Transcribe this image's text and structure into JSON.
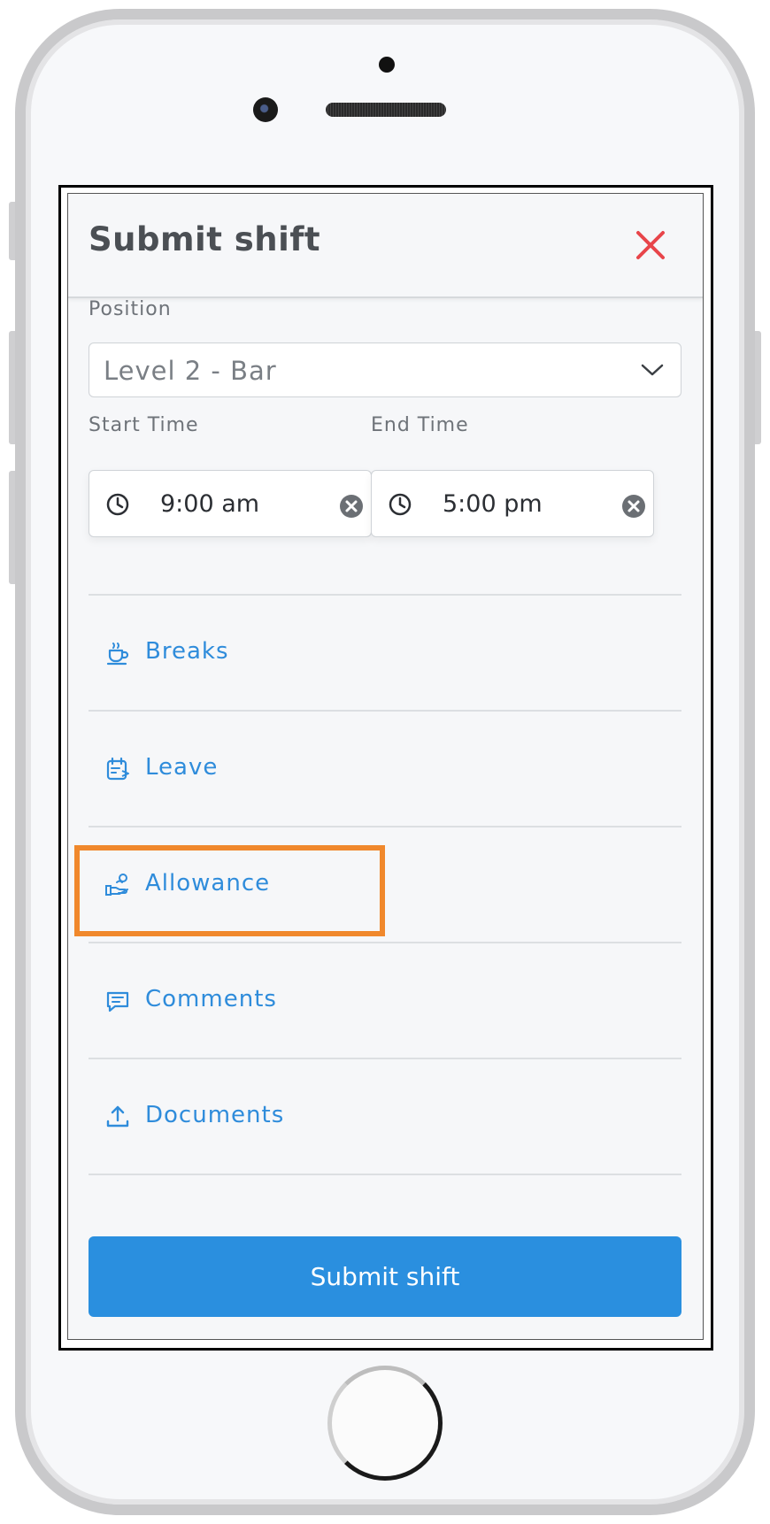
{
  "modal": {
    "title": "Submit shift",
    "close_icon": "close-icon"
  },
  "position": {
    "label": "Position",
    "value": "Level 2 - Bar"
  },
  "start_time": {
    "label": "Start Time",
    "value": "9:00 am"
  },
  "end_time": {
    "label": "End Time",
    "value": "5:00 pm"
  },
  "sections": [
    {
      "label": "Breaks",
      "icon": "coffee-cup-icon"
    },
    {
      "label": "Leave",
      "icon": "calendar-leave-icon"
    },
    {
      "label": "Allowance",
      "icon": "hand-coin-icon"
    },
    {
      "label": "Comments",
      "icon": "chat-bubble-icon"
    },
    {
      "label": "Documents",
      "icon": "upload-icon"
    }
  ],
  "submit": {
    "label": "Submit shift"
  },
  "colors": {
    "accent": "#2a8fdf",
    "highlight": "#f0882c",
    "close": "#e8454a"
  }
}
